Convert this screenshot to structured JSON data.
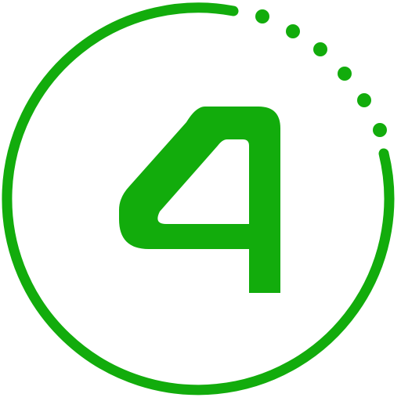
{
  "icon": {
    "name": "countdown-four-icon",
    "digit": "4",
    "color": "#12ac0c",
    "background": "#ffffff",
    "progress_dots": 6
  }
}
